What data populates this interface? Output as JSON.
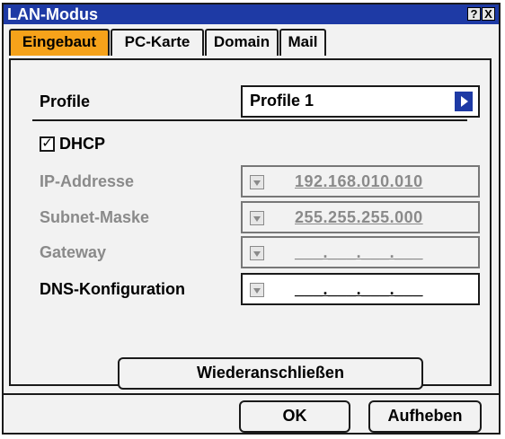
{
  "window": {
    "title": "LAN-Modus",
    "help_button": "?",
    "close_button": "X"
  },
  "tabs": [
    {
      "label": "Eingebaut",
      "active": true
    },
    {
      "label": "PC-Karte",
      "active": false
    },
    {
      "label": "Domain",
      "active": false
    },
    {
      "label": "Mail",
      "active": false
    }
  ],
  "profile": {
    "label": "Profile",
    "value": "Profile 1"
  },
  "dhcp": {
    "label": "DHCP",
    "checked": true,
    "check_mark": "✓"
  },
  "fields": {
    "ip": {
      "label": "IP-Addresse",
      "value": "192.168.010.010",
      "enabled": false
    },
    "subnet": {
      "label": "Subnet-Maske",
      "value": "255.255.255.000",
      "enabled": false
    },
    "gateway": {
      "label": "Gateway",
      "value": "___.___.___.___",
      "enabled": false
    },
    "dns": {
      "label": "DNS-Konfiguration",
      "value": "___.___.___.___",
      "enabled": true
    }
  },
  "buttons": {
    "reconnect": "Wiederanschließen",
    "ok": "OK",
    "cancel": "Aufheben"
  },
  "colors": {
    "titlebar": "#1e3aa5",
    "active_tab": "#f6a21a",
    "disabled_text": "#8a8a8a"
  }
}
